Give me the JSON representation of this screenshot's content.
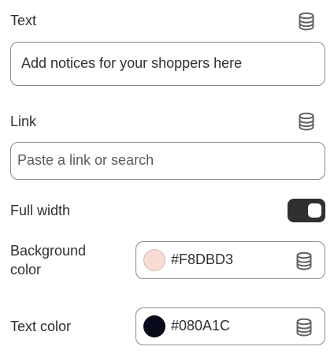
{
  "text_setting": {
    "label": "Text",
    "value": "Add notices for your shoppers here",
    "icon": "database-icon"
  },
  "link_setting": {
    "label": "Link",
    "placeholder": "Paste a link or search",
    "value": "",
    "icon": "database-icon"
  },
  "full_width_setting": {
    "label": "Full width",
    "checked": true
  },
  "background_color_setting": {
    "label_line1": "Background",
    "label_line2": "color",
    "hex": "#F8DBD3",
    "swatch_color": "#F8DBD3",
    "icon": "database-icon"
  },
  "text_color_setting": {
    "label": "Text color",
    "hex": "#080A1C",
    "swatch_color": "#080A1C",
    "icon": "database-icon"
  }
}
